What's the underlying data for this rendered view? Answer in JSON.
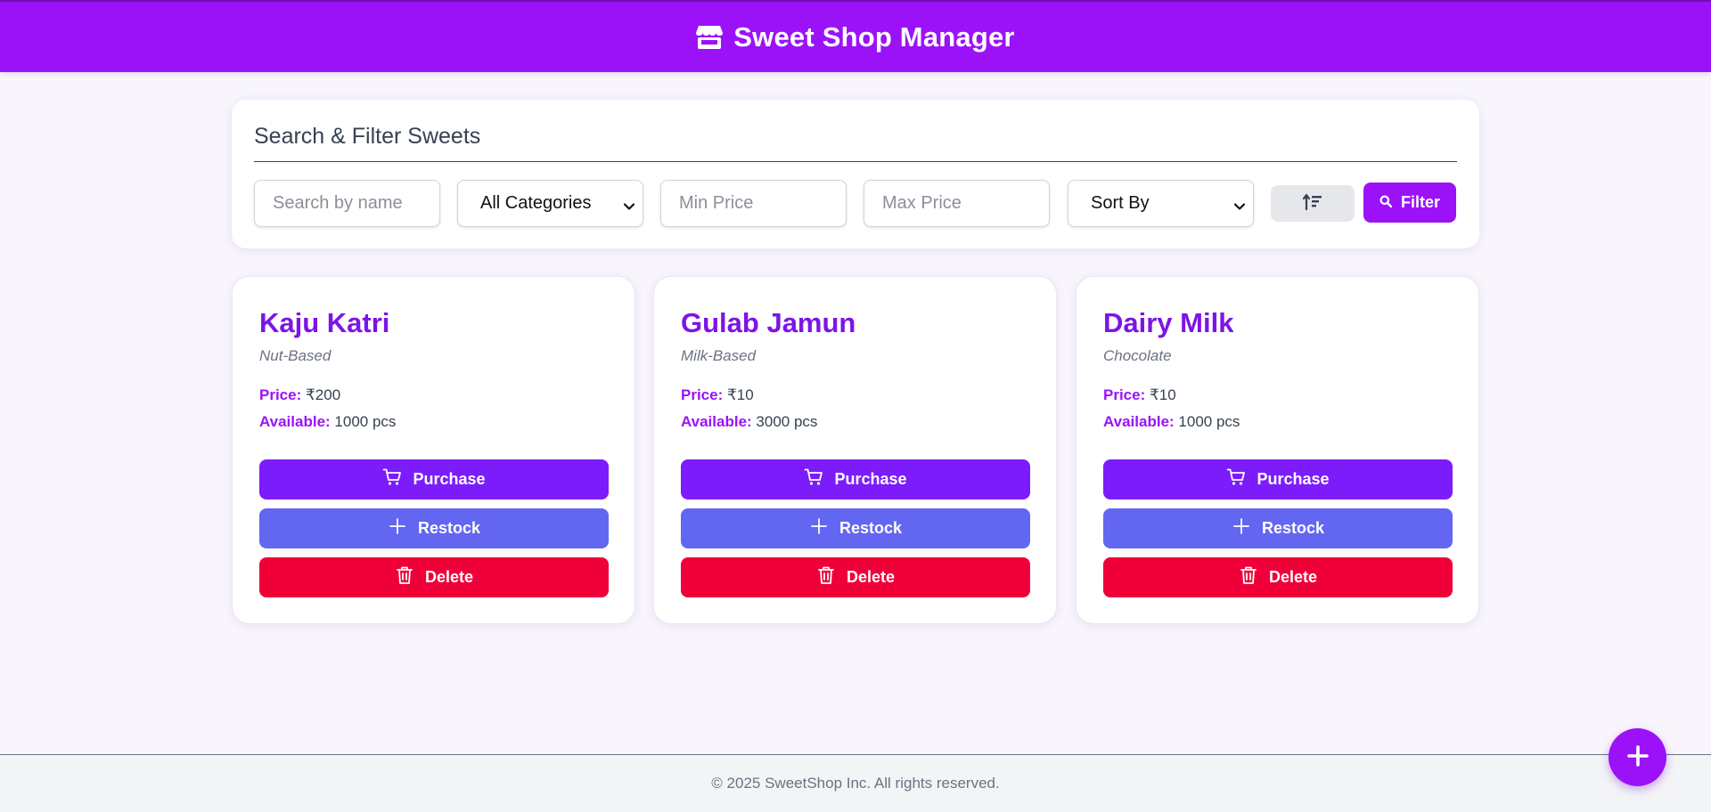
{
  "header": {
    "title": "Sweet Shop Manager",
    "icon": "store-icon"
  },
  "filters": {
    "title": "Search & Filter Sweets",
    "search_placeholder": "Search by name",
    "category_selected": "All Categories",
    "min_price_placeholder": "Min Price",
    "max_price_placeholder": "Max Price",
    "sort_selected": "Sort By",
    "sort_toggle_icon": "sort-ascending-icon",
    "filter_label": "Filter"
  },
  "labels": {
    "price": "Price:",
    "available": "Available:"
  },
  "sweets": [
    {
      "name": "Kaju Katri",
      "category": "Nut-Based",
      "price": "₹200",
      "available": "1000 pcs",
      "purchase": "Purchase",
      "restock": "Restock",
      "delete": "Delete"
    },
    {
      "name": "Gulab Jamun",
      "category": "Milk-Based",
      "price": "₹10",
      "available": "3000 pcs",
      "purchase": "Purchase",
      "restock": "Restock",
      "delete": "Delete"
    },
    {
      "name": "Dairy Milk",
      "category": "Chocolate",
      "price": "₹10",
      "available": "1000 pcs",
      "purchase": "Purchase",
      "restock": "Restock",
      "delete": "Delete"
    }
  ],
  "footer": {
    "text": "© 2025 SweetShop Inc. All rights reserved."
  },
  "fab": {
    "icon": "plus-icon"
  },
  "colors": {
    "brand": "#9b12f9",
    "purchase": "#7c1cfb",
    "restock": "#6366f1",
    "delete": "#ef0039"
  }
}
